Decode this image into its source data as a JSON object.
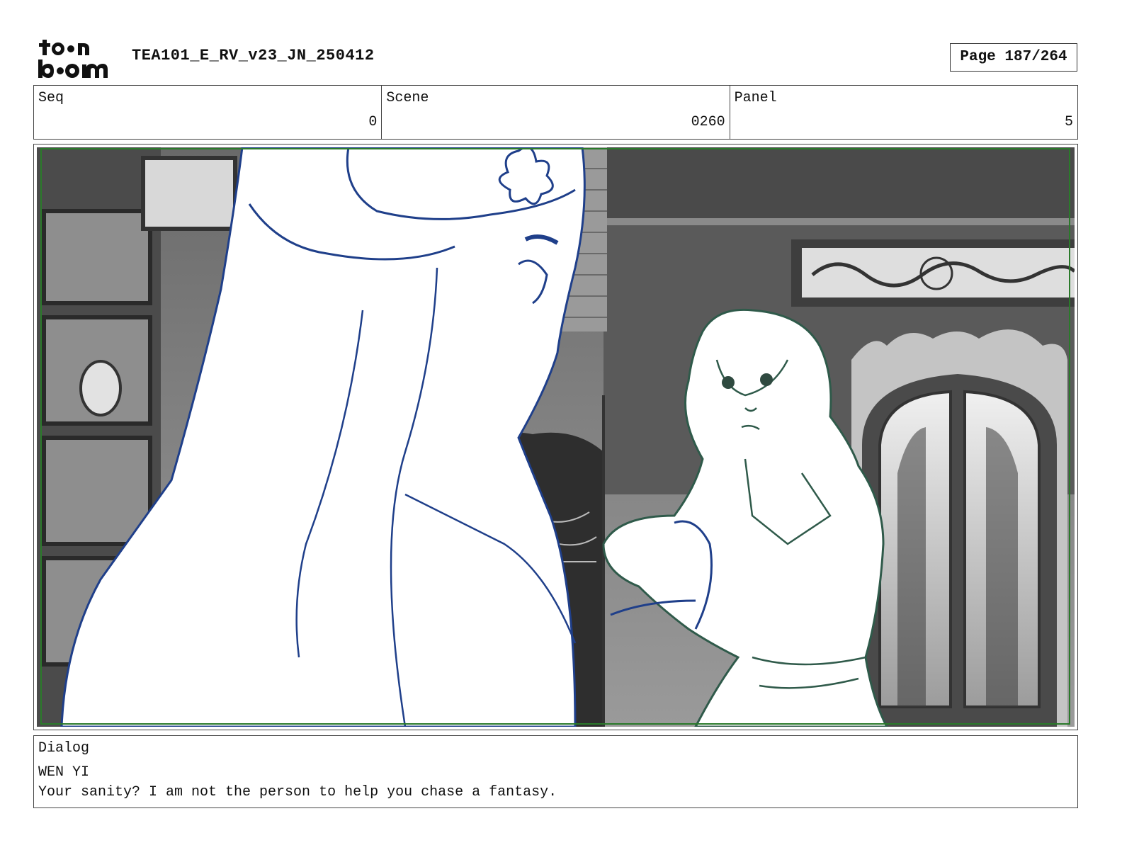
{
  "header": {
    "logo_text": "toon boom",
    "doc_title": "TEA101_E_RV_v23_JN_250412",
    "page_label": "Page 187/264"
  },
  "meta": {
    "seq": {
      "label": "Seq",
      "value": "0"
    },
    "scene": {
      "label": "Scene",
      "value": "0260"
    },
    "panel": {
      "label": "Panel",
      "value": "5"
    }
  },
  "panel_image": {
    "description_icon": "storyboard-panel-image",
    "colors": {
      "character_left": "#1f3f8a",
      "character_right": "#2f5a4a",
      "safe_frame": "#2a7a2a"
    }
  },
  "dialog": {
    "label": "Dialog",
    "speaker": "WEN YI",
    "text": "Your sanity? I am not the person to help you chase a fantasy."
  }
}
